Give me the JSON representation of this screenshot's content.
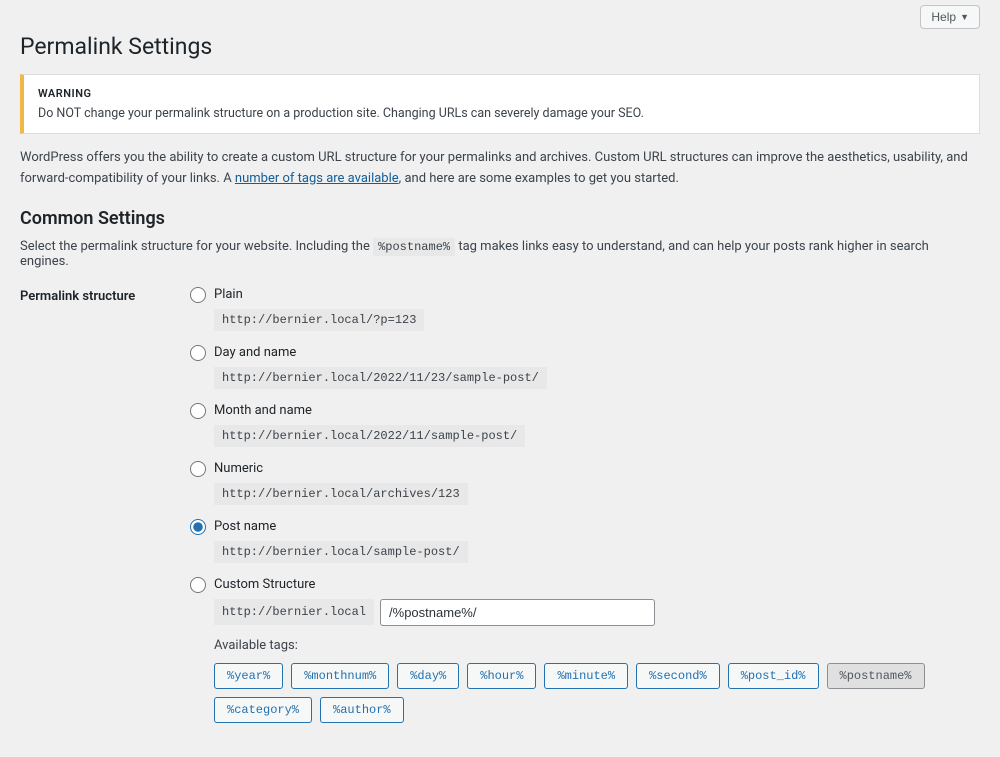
{
  "topBar": {
    "helpLabel": "Help"
  },
  "pageTitle": "Permalink Settings",
  "warning": {
    "title": "WARNING",
    "body": "Do NOT change your permalink structure on a production site. Changing URLs can severely damage your SEO."
  },
  "intro": {
    "text1": "WordPress offers you the ability to create a custom URL structure for your permalinks and archives. Custom URL structures can improve the aesthetics, usability, and forward-compatibility of your links. A ",
    "linkText": "number of tags are available",
    "text2": ", and here are some examples to get you started."
  },
  "commonSettings": {
    "heading": "Common Settings",
    "sub1": "Select the permalink structure for your website. Including the ",
    "subCode": "%postname%",
    "sub2": " tag makes links easy to understand, and can help your posts rank higher in search engines."
  },
  "form": {
    "label": "Permalink structure",
    "options": [
      {
        "id": "plain",
        "label": "Plain",
        "example": "http://bernier.local/?p=123",
        "checked": false
      },
      {
        "id": "dayname",
        "label": "Day and name",
        "example": "http://bernier.local/2022/11/23/sample-post/",
        "checked": false
      },
      {
        "id": "monthname",
        "label": "Month and name",
        "example": "http://bernier.local/2022/11/sample-post/",
        "checked": false
      },
      {
        "id": "numeric",
        "label": "Numeric",
        "example": "http://bernier.local/archives/123",
        "checked": false
      },
      {
        "id": "postname",
        "label": "Post name",
        "example": "http://bernier.local/sample-post/",
        "checked": true
      },
      {
        "id": "custom",
        "label": "Custom Structure",
        "checked": false
      }
    ],
    "customBase": "http://bernier.local",
    "customValue": "/%postname%/",
    "availableTagsLabel": "Available tags:",
    "tags": [
      {
        "label": "%year%",
        "active": false
      },
      {
        "label": "%monthnum%",
        "active": false
      },
      {
        "label": "%day%",
        "active": false
      },
      {
        "label": "%hour%",
        "active": false
      },
      {
        "label": "%minute%",
        "active": false
      },
      {
        "label": "%second%",
        "active": false
      },
      {
        "label": "%post_id%",
        "active": false
      },
      {
        "label": "%postname%",
        "active": true
      },
      {
        "label": "%category%",
        "active": false
      },
      {
        "label": "%author%",
        "active": false
      }
    ]
  }
}
